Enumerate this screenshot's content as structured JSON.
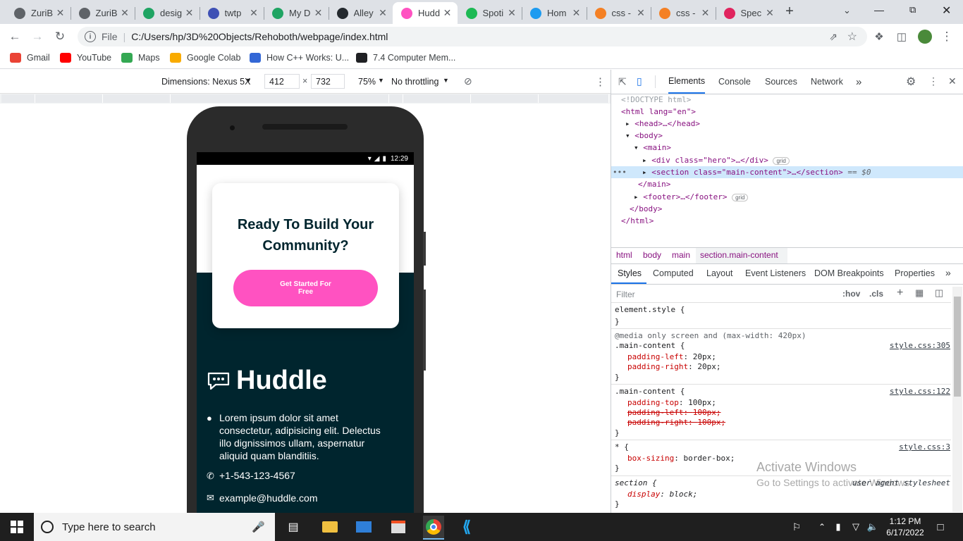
{
  "tabs": [
    {
      "title": "ZuriB",
      "icon": "globe-icon",
      "color": "#5f6368"
    },
    {
      "title": "ZuriB",
      "icon": "globe-icon",
      "color": "#5f6368"
    },
    {
      "title": "desig",
      "icon": "google-drive-icon",
      "color": "#1fa463"
    },
    {
      "title": "twtp",
      "icon": "twtp-icon",
      "color": "#3f51b5"
    },
    {
      "title": "My D",
      "icon": "google-drive-icon",
      "color": "#1fa463"
    },
    {
      "title": "Alley",
      "icon": "github-icon",
      "color": "#24292e"
    },
    {
      "title": "Hudd",
      "icon": "huddle-icon",
      "color": "#ff52c1"
    },
    {
      "title": "Spoti",
      "icon": "spotify-icon",
      "color": "#1db954"
    },
    {
      "title": "Hom",
      "icon": "twitter-icon",
      "color": "#1d9bf0"
    },
    {
      "title": "css -",
      "icon": "stackoverflow-icon",
      "color": "#f48024"
    },
    {
      "title": "css -",
      "icon": "stackoverflow-icon",
      "color": "#f48024"
    },
    {
      "title": "Spec",
      "icon": "spec-icon",
      "color": "#e0245e"
    }
  ],
  "new_tab_symbol": "+",
  "tab_close_symbol": "✕",
  "url": {
    "scheme_label": "File",
    "path": "C:/Users/hp/3D%20Objects/Rehoboth/webpage/index.html"
  },
  "bookmarks": [
    {
      "label": "Gmail",
      "icon": "gmail-icon",
      "color": "#ea4335"
    },
    {
      "label": "YouTube",
      "icon": "youtube-icon",
      "color": "#ff0000"
    },
    {
      "label": "Maps",
      "icon": "maps-icon",
      "color": "#34a853"
    },
    {
      "label": "Google Colab",
      "icon": "colab-icon",
      "color": "#f9ab00"
    },
    {
      "label": "How C++ Works: U...",
      "icon": "bookmark-icon",
      "color": "#3367d6"
    },
    {
      "label": "7.4 Computer Mem...",
      "icon": "w-icon",
      "color": "#202124"
    }
  ],
  "device_toolbar": {
    "dimensions_label": "Dimensions: Nexus 5X",
    "width": "412",
    "height": "732",
    "zoom": "75%",
    "throttling": "No throttling",
    "times": "×"
  },
  "phone_page": {
    "status_time": "12:29",
    "cta_title": "Ready To Build Your Community?",
    "cta_button": "Get Started For Free",
    "brand": "Huddle",
    "address": "Lorem ipsum dolor sit amet consectetur, adipisicing elit. Delectus illo dignissimos ullam, aspernatur aliquid quam blanditiis.",
    "phone": "+1-543-123-4567",
    "email": "example@huddle.com"
  },
  "devtools": {
    "tabs": [
      "Elements",
      "Console",
      "Sources",
      "Network"
    ],
    "more": "»",
    "dom": {
      "doctype": "<!DOCTYPE html>",
      "html_open": "<html lang=\"en\">",
      "head": "<head>…</head>",
      "body_open": "<body>",
      "main_open": "<main>",
      "hero": "<div class=\"hero\">…</div>",
      "section": "<section class=\"main-content\">…</section>",
      "selected_suffix": "== $0",
      "main_close": "</main>",
      "footer": "<footer>…</footer>",
      "body_close": "</body>",
      "html_close": "</html>",
      "grid_badge": "grid",
      "dots": "•••"
    },
    "breadcrumbs": [
      "html",
      "body",
      "main",
      "section.main-content"
    ],
    "styles_tabs": [
      "Styles",
      "Computed",
      "Layout",
      "Event Listeners",
      "DOM Breakpoints",
      "Properties"
    ],
    "filter_placeholder": "Filter",
    "hov": ":hov",
    "cls": ".cls",
    "rules": {
      "element_style": "element.style {",
      "close": "}",
      "media": "@media only screen and (max-width: 420px)",
      "r1_selector": ".main-content {",
      "r1_src": "style.css:305",
      "r1_p1": "padding-left",
      "r1_v1": "20px;",
      "r1_p2": "padding-right",
      "r1_v2": "20px;",
      "r2_selector": ".main-content {",
      "r2_src": "style.css:122",
      "r2_p1": "padding-top",
      "r2_v1": "100px;",
      "r2_p2": "padding-left",
      "r2_v2": "100px;",
      "r2_p3": "padding-right",
      "r2_v3": "100px;",
      "r3_selector": "* {",
      "r3_src": "style.css:3",
      "r3_p1": "box-sizing",
      "r3_v1": "border-box;",
      "r4_selector": "section {",
      "r4_src": "user agent stylesheet",
      "r4_p1": "display",
      "r4_v1": "block;"
    }
  },
  "watermark": {
    "line1": "Activate Windows",
    "line2": "Go to Settings to activate Windows."
  },
  "taskbar": {
    "search_placeholder": "Type here to search",
    "time": "1:12 PM",
    "date": "6/17/2022"
  }
}
